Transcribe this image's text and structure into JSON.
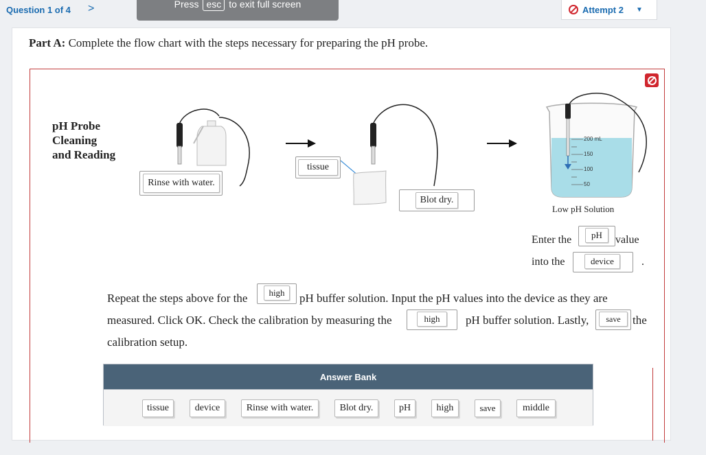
{
  "topbar": {
    "question_nav": "Question 1 of 4",
    "next_arrow": ">",
    "fullscreen_banner": {
      "press": "Press",
      "key": "esc",
      "rest": "to exit full screen"
    },
    "attempt": {
      "label": "Attempt 2",
      "caret": "▼"
    }
  },
  "question": {
    "part_label": "Part A:",
    "prompt": "Complete the flow chart with the steps necessary for preparing the pH probe."
  },
  "flowchart": {
    "side_label": [
      "pH Probe",
      "Cleaning",
      "and Reading"
    ],
    "steps": {
      "step1_answer": "Rinse with water.",
      "tissue_label": "tissue",
      "step2_answer": "Blot dry."
    },
    "beaker": {
      "marks": [
        "200 mL",
        "150",
        "100",
        "50"
      ],
      "label": "Low pH Solution"
    },
    "enter_sentence": {
      "prefix": "Enter the",
      "slot1": "pH",
      "suffix1": "value",
      "prefix2": "into the",
      "slot2": "device",
      "end": "."
    },
    "repeat_paragraph": {
      "l1_a": "Repeat the steps above for the",
      "l1_slot": "high",
      "l1_b": "pH buffer solution. Input the pH values into the device as they are",
      "l2_a": "measured. Click OK. Check the calibration by measuring the",
      "l2_slot": "high",
      "l2_b": "pH buffer solution. Lastly,",
      "l2_slot2": "save",
      "l2_c": "the",
      "l3": "calibration setup."
    }
  },
  "answer_bank": {
    "title": "Answer Bank",
    "items": [
      "tissue",
      "device",
      "Rinse with water.",
      "Blot dry.",
      "pH",
      "high",
      "save",
      "middle"
    ]
  },
  "colors": {
    "link_blue": "#1a6bb0",
    "reset_red": "#d0262e",
    "bank_header": "#4a6378",
    "liquid": "#a9dde8"
  }
}
